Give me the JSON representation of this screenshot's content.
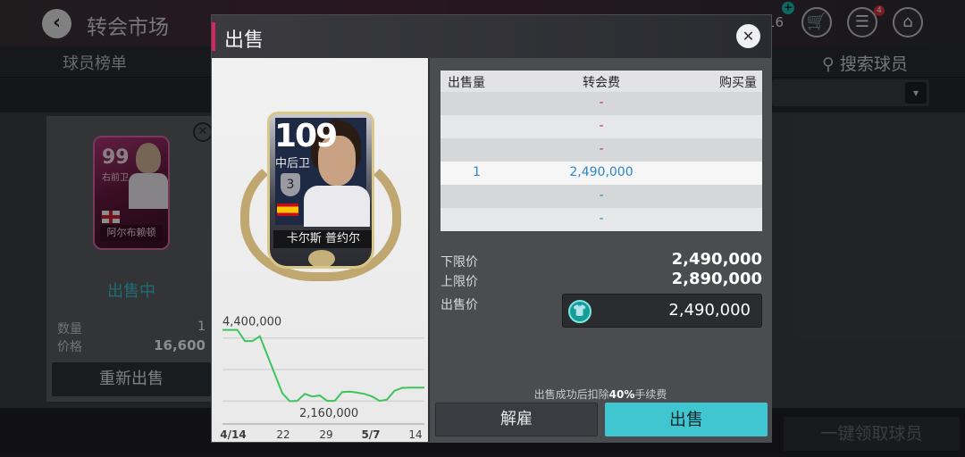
{
  "header": {
    "title": "转会市场",
    "coin_count": "16",
    "notification_count": "4"
  },
  "tabs": {
    "left_label": "球员榜单",
    "search_label": "搜索球员"
  },
  "listing_card": {
    "player_rating": "99",
    "player_position": "右前卫",
    "player_name": "阿尔布赖顿",
    "status": "出售中",
    "quantity_label": "数量",
    "quantity_value": "1",
    "price_label": "价格",
    "price_value": "16,600",
    "relist_label": "重新出售"
  },
  "bottom": {
    "claim_all_label": "一键领取球员"
  },
  "dialog": {
    "title": "出售",
    "card": {
      "rating": "109",
      "position": "中后卫",
      "level": "3",
      "name": "卡尔斯 普约尔"
    },
    "table": {
      "headers": {
        "qty": "出售量",
        "fee": "转会费",
        "buy": "购买量"
      },
      "rows": [
        {
          "qty": "",
          "fee": "-",
          "fee_color": "red"
        },
        {
          "qty": "",
          "fee": "-",
          "fee_color": "red"
        },
        {
          "qty": "",
          "fee": "-",
          "fee_color": "red"
        },
        {
          "qty": "1",
          "fee": "2,490,000",
          "fee_color": "blue"
        },
        {
          "qty": "",
          "fee": "-",
          "fee_color": "blue"
        },
        {
          "qty": "",
          "fee": "-",
          "fee_color": "blue"
        }
      ]
    },
    "lower_limit_label": "下限价",
    "lower_limit_value": "2,490,000",
    "upper_limit_label": "上限价",
    "upper_limit_value": "2,890,000",
    "sell_price_label": "出售价",
    "sell_price_value": "2,490,000",
    "fee_note_prefix": "出售成功后扣除",
    "fee_note_bold": "40%",
    "fee_note_suffix": "手续费",
    "release_label": "解雇",
    "sell_label": "出售"
  },
  "chart_data": {
    "type": "line",
    "title": "",
    "xlabel": "",
    "ylabel": "",
    "x_tick_labels": [
      "4/14",
      "22",
      "29",
      "5/7",
      "14"
    ],
    "bold_ticks": [
      "4/14",
      "5/7"
    ],
    "annotations": [
      {
        "text": "4,400,000",
        "value": 4400000
      },
      {
        "text": "2,160,000",
        "value": 2160000
      }
    ],
    "series": [
      {
        "values": [
          4400000,
          4400000,
          4400000,
          4050000,
          4050000,
          4200000,
          3600000,
          3000000,
          2400000,
          2150000,
          2160000,
          2380000,
          2300000,
          2330000,
          2160000,
          2160000,
          2440000,
          2450000,
          2420000,
          2380000,
          2300000,
          2160000,
          2200000,
          2480000,
          2570000,
          2580000,
          2580000,
          2580000
        ]
      }
    ],
    "ylim": [
      1600000,
      4700000
    ],
    "grid": true,
    "line_color": "#3fc45c"
  }
}
